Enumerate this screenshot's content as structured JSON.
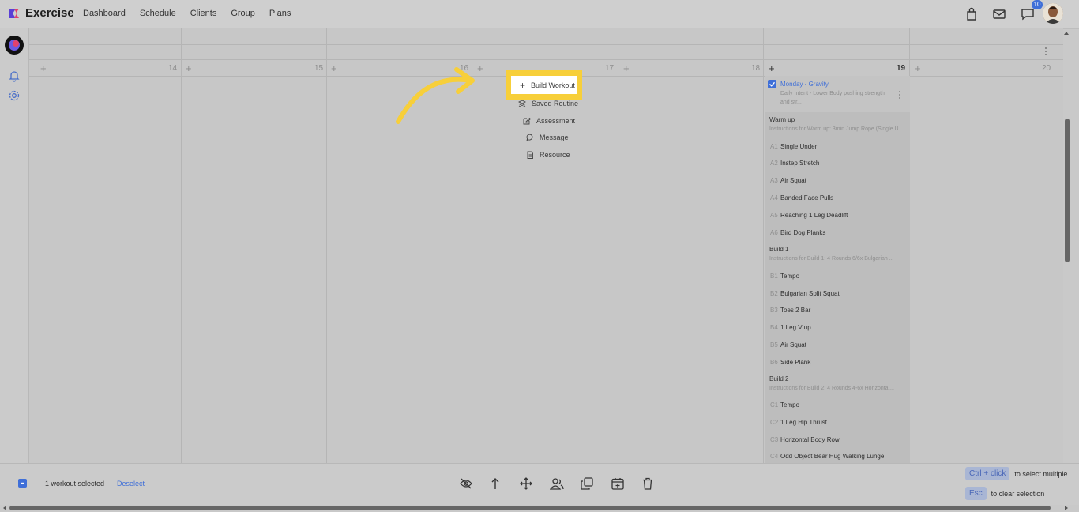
{
  "app": {
    "title": "Exercise"
  },
  "nav": {
    "items": [
      "Dashboard",
      "Schedule",
      "Clients",
      "Group",
      "Plans"
    ]
  },
  "topbar": {
    "notification_count": "10"
  },
  "calendar": {
    "days": [
      {
        "num": "14"
      },
      {
        "num": "15"
      },
      {
        "num": "16"
      },
      {
        "num": "17"
      },
      {
        "num": "18"
      },
      {
        "num": "19"
      },
      {
        "num": "20"
      }
    ]
  },
  "add_menu": {
    "build_workout": "Build Workout",
    "saved_routine": "Saved Routine",
    "assessment": "Assessment",
    "message": "Message",
    "resource": "Resource"
  },
  "workout": {
    "title": "Monday - Gravity",
    "description_line1": "Daily Intent - Lower Body pushing strength",
    "description_line2": "and str...",
    "sections": [
      {
        "name": "Warm up",
        "instructions": "Instructions for Warm up: 3min Jump Rope (Single U..."
      },
      {
        "name": "Build 1",
        "instructions": "Instructions for Build 1: 4 Rounds 6/6x Bulgarian ..."
      },
      {
        "name": "Build 2",
        "instructions": "Instructions for Build 2: 4 Rounds 4-6x Horizontal..."
      }
    ],
    "exercises": [
      {
        "code": "A1",
        "name": "Single Under"
      },
      {
        "code": "A2",
        "name": "Instep Stretch"
      },
      {
        "code": "A3",
        "name": "Air Squat"
      },
      {
        "code": "A4",
        "name": "Banded Face Pulls"
      },
      {
        "code": "A5",
        "name": "Reaching 1 Leg Deadlift"
      },
      {
        "code": "A6",
        "name": "Bird Dog Planks"
      },
      {
        "code": "B1",
        "name": "Tempo"
      },
      {
        "code": "B2",
        "name": "Bulgarian Split Squat"
      },
      {
        "code": "B3",
        "name": "Toes 2 Bar"
      },
      {
        "code": "B4",
        "name": "1 Leg V up"
      },
      {
        "code": "B5",
        "name": "Air Squat"
      },
      {
        "code": "B6",
        "name": "Side Plank"
      },
      {
        "code": "C1",
        "name": "Tempo"
      },
      {
        "code": "C2",
        "name": "1 Leg Hip Thrust"
      },
      {
        "code": "C3",
        "name": "Horizontal Body Row"
      },
      {
        "code": "C4",
        "name": "Odd Object Bear Hug Walking Lunge"
      }
    ]
  },
  "selection": {
    "count_label": "1 workout selected",
    "deselect_label": "Deselect"
  },
  "hints": {
    "multi_key": "Ctrl + click",
    "multi_text": "to select multiple",
    "clear_key": "Esc",
    "clear_text": "to clear selection"
  },
  "colors": {
    "accent": "#3f6fd8",
    "highlight": "#f7cf3a"
  }
}
